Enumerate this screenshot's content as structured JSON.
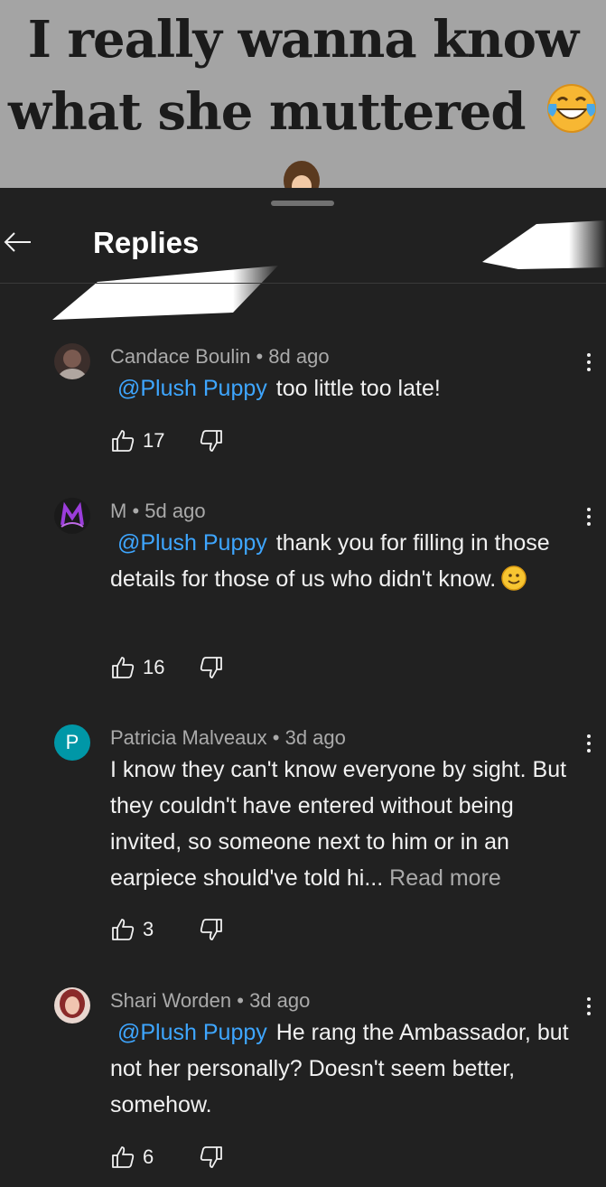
{
  "video": {
    "caption_line1": "I really wanna know",
    "caption_line2": "what she muttered",
    "emoji": "laughing-tears-emoji"
  },
  "header": {
    "title": "Replies",
    "back_icon": "arrow-left-icon"
  },
  "comments": [
    {
      "author": "Candace Boulin",
      "age": "8d ago",
      "mention": "@Plush Puppy",
      "text": "too little too late!",
      "likes": "17",
      "avatar_color": "#5a4a44"
    },
    {
      "author": "M",
      "age": "5d ago",
      "mention": "@Plush Puppy",
      "text": "thank you for filling in those details for those of us who didn't know.",
      "likes": "16",
      "avatar_color": "#1a1a1a"
    },
    {
      "author": "Patricia Malveaux",
      "age": "3d ago",
      "avatar_letter": "P",
      "text": "I know they can't know everyone by sight. But they couldn't have entered without being invited, so someone next to him or in an earpiece should've told hi...",
      "read_more": "Read more",
      "likes": "3",
      "avatar_color": "#0097a7"
    },
    {
      "author": "Shari Worden",
      "age": "3d ago",
      "mention": "@Plush Puppy",
      "text": "He rang the Ambassador, but not her personally? Doesn't seem better, somehow.",
      "likes": "6",
      "avatar_color": "#c98a7a"
    }
  ],
  "separator": "•",
  "colors": {
    "background": "#212121",
    "mention": "#3ea6ff",
    "meta": "#aaaaaa",
    "text": "#f1f1f1"
  }
}
